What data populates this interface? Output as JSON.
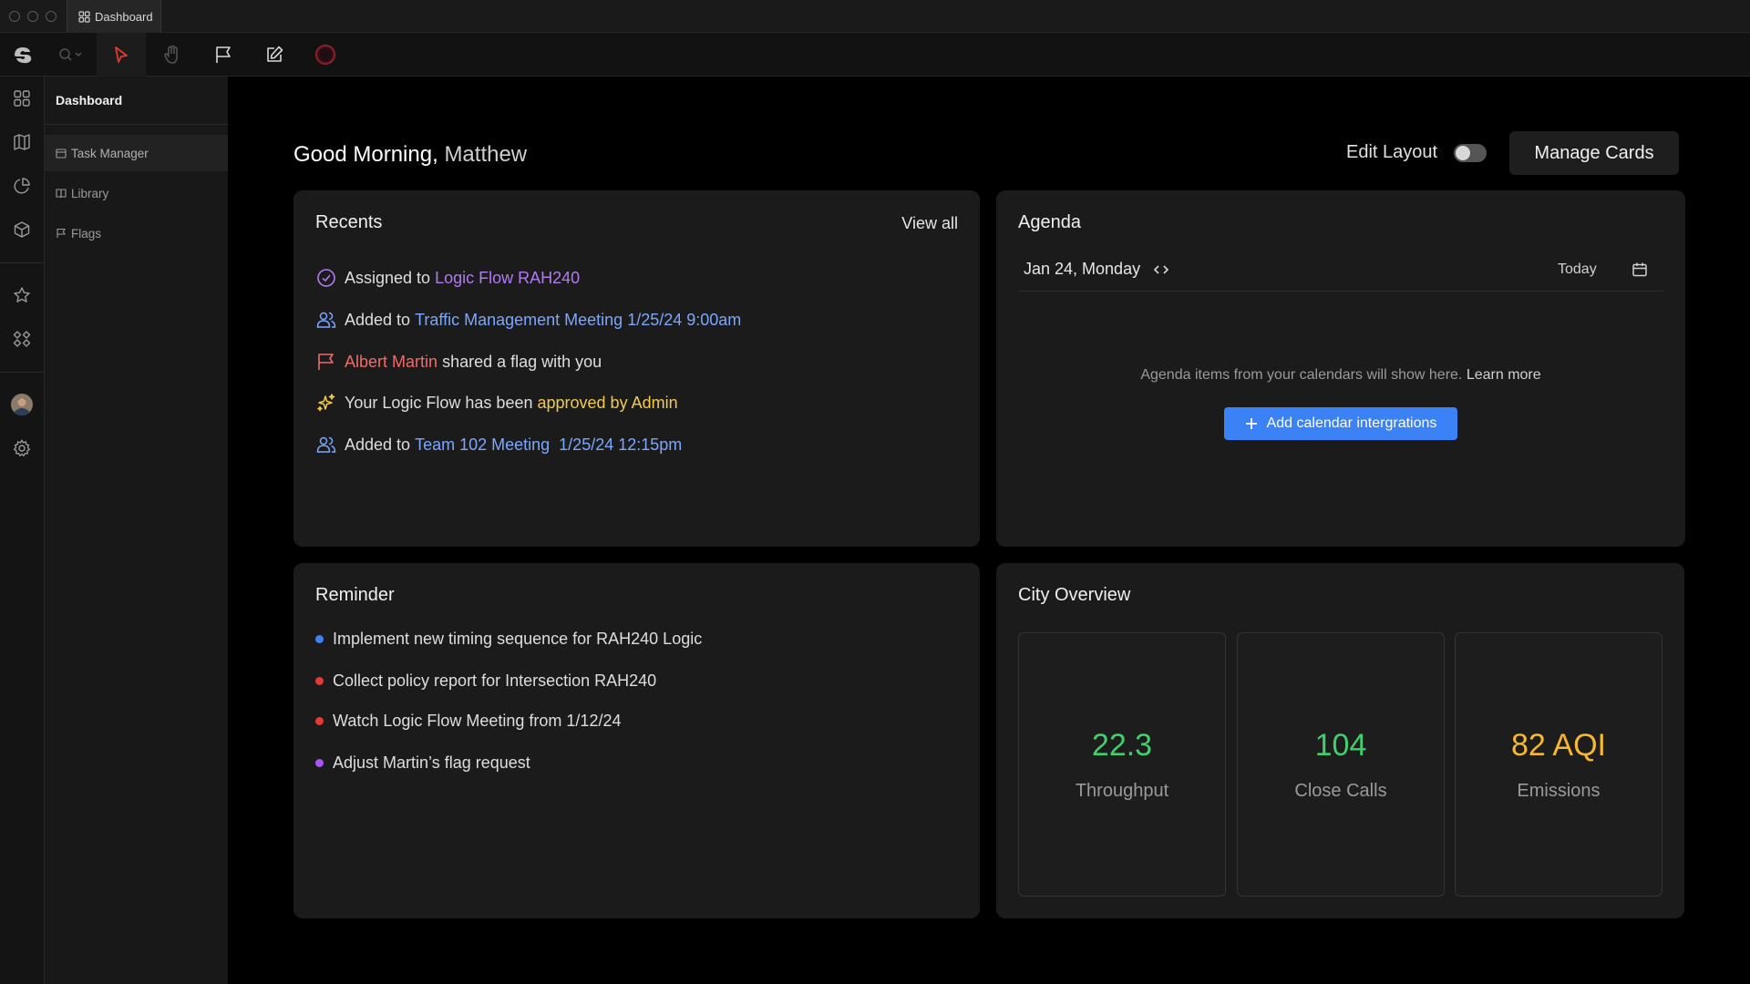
{
  "window": {
    "tab_label": "Dashboard"
  },
  "toolbar": {
    "tools": [
      "zoom-tool",
      "select-tool",
      "pan-tool",
      "flag-tool",
      "edit-tool",
      "record-tool"
    ],
    "active_tool": "select-tool",
    "accent": "#e53935"
  },
  "sidenav": {
    "title": "Dashboard",
    "items": [
      {
        "label": "Task Manager",
        "icon": "calendar-icon",
        "active": true
      },
      {
        "label": "Library",
        "icon": "book-icon",
        "active": false
      },
      {
        "label": "Flags",
        "icon": "flag-icon",
        "active": false
      }
    ]
  },
  "header": {
    "greeting": "Good Morning,",
    "user_name": "Matthew",
    "edit_layout_label": "Edit Layout",
    "edit_layout_on": false,
    "manage_cards_label": "Manage Cards"
  },
  "recents": {
    "title": "Recents",
    "view_all": "View all",
    "items": [
      {
        "icon": "check-circle-icon",
        "pre": "Assigned to ",
        "link": "Logic Flow RAH240",
        "post": ""
      },
      {
        "icon": "users-icon",
        "pre": "Added to ",
        "link": "Traffic Management Meeting 1/25/24 9:00am",
        "post": ""
      },
      {
        "icon": "flag-icon",
        "pre": "",
        "link": "Albert Martin",
        "post": " shared a flag with you"
      },
      {
        "icon": "sparkles-icon",
        "pre": "Your Logic Flow has been ",
        "link": "approved by Admin",
        "post": ""
      },
      {
        "icon": "users-icon",
        "pre": "Added to ",
        "link": "Team 102 Meeting  1/25/24 12:15pm",
        "post": ""
      }
    ]
  },
  "agenda": {
    "title": "Agenda",
    "date": "Jan 24, Monday",
    "today_label": "Today",
    "empty_text": "Agenda items from your calendars will show here.",
    "learn_more": "Learn more",
    "add_button": "Add calendar intergrations"
  },
  "reminder": {
    "title": "Reminder",
    "items": [
      {
        "text": "Implement new timing sequence for RAH240 Logic",
        "color": "#3b82f6"
      },
      {
        "text": "Collect policy report for Intersection RAH240",
        "color": "#e53935"
      },
      {
        "text": "Watch Logic Flow Meeting from 1/12/24",
        "color": "#e53935"
      },
      {
        "text": "Adjust Martin’s flag request",
        "color": "#a855f7"
      }
    ]
  },
  "city": {
    "title": "City Overview",
    "stats": [
      {
        "value": "22.3",
        "label": "Throughput",
        "color": "#3fcf6b"
      },
      {
        "value": "104",
        "label": "Close Calls",
        "color": "#3fcf6b"
      },
      {
        "value": "82 AQI",
        "label": "Emissions",
        "color": "#f5b82e"
      }
    ]
  }
}
